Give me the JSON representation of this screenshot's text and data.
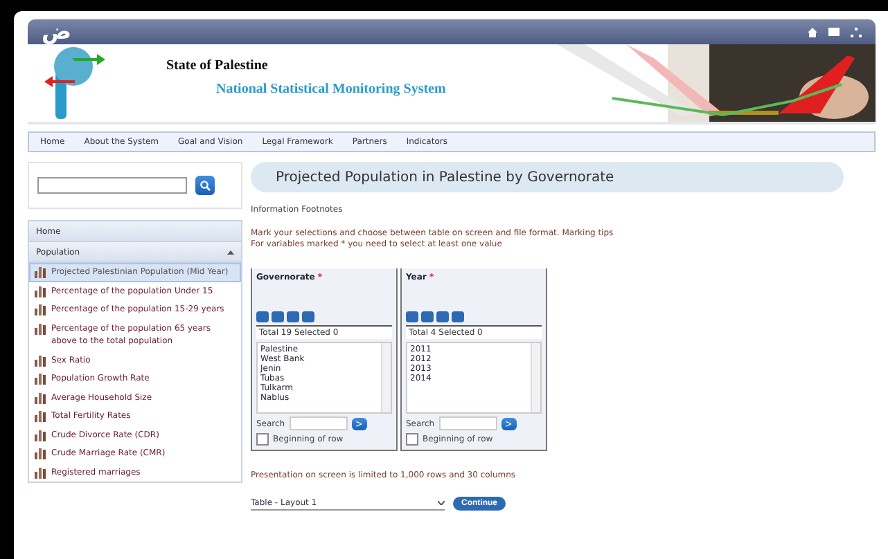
{
  "top_bar": {
    "logo_text": "ض"
  },
  "header": {
    "title": "State of Palestine",
    "subtitle": "National Statistical Monitoring System"
  },
  "nav": [
    "Home",
    "About the System",
    "Goal and Vision",
    "Legal Framework",
    "Partners",
    "Indicators"
  ],
  "sidebar": {
    "sections": [
      {
        "label": "Home",
        "expanded": false
      },
      {
        "label": "Population",
        "expanded": true
      }
    ],
    "items": [
      {
        "label": "Projected Palestinian Population (Mid Year)",
        "selected": true
      },
      {
        "label": "Percentage of the population Under 15",
        "selected": false
      },
      {
        "label": "Percentage of the population 15-29 years",
        "selected": false
      },
      {
        "label": "Percentage of the population 65 years above to the total population",
        "selected": false
      },
      {
        "label": "Sex Ratio",
        "selected": false
      },
      {
        "label": "Population Growth Rate",
        "selected": false
      },
      {
        "label": "Average Household Size",
        "selected": false
      },
      {
        "label": "Total Fertility Rates",
        "selected": false
      },
      {
        "label": "Crude Divorce Rate (CDR)",
        "selected": false
      },
      {
        "label": "Crude Marriage Rate (CMR)",
        "selected": false
      },
      {
        "label": "Registered marriages",
        "selected": false
      }
    ]
  },
  "page_title": "Projected Population in Palestine by Governorate",
  "info_links": "Information Footnotes",
  "instructions": [
    "Mark your selections and choose between table on screen and file format. Marking tips",
    "For variables marked * you need to select at least one value"
  ],
  "variables": [
    {
      "name": "Governorate",
      "required_mark": "*",
      "summary": "Total 19 Selected 0",
      "values": [
        "Palestine",
        "West Bank",
        "Jenin",
        "Tubas",
        "Tulkarm",
        "Nablus"
      ],
      "search_label": "Search",
      "search_button": ">",
      "beginning_label": "Beginning of row",
      "beginning_checked": false
    },
    {
      "name": "Year",
      "required_mark": "*",
      "summary": "Total 4 Selected 0",
      "values": [
        "2011",
        "2012",
        "2013",
        "2014"
      ],
      "search_label": "Search",
      "search_button": ">",
      "beginning_label": "Beginning of row",
      "beginning_checked": false
    }
  ],
  "limit_note": "Presentation on screen is limited to 1,000 rows and 30 columns",
  "layout_select": {
    "value": "Table - Layout 1"
  },
  "continue_button": "Continue"
}
